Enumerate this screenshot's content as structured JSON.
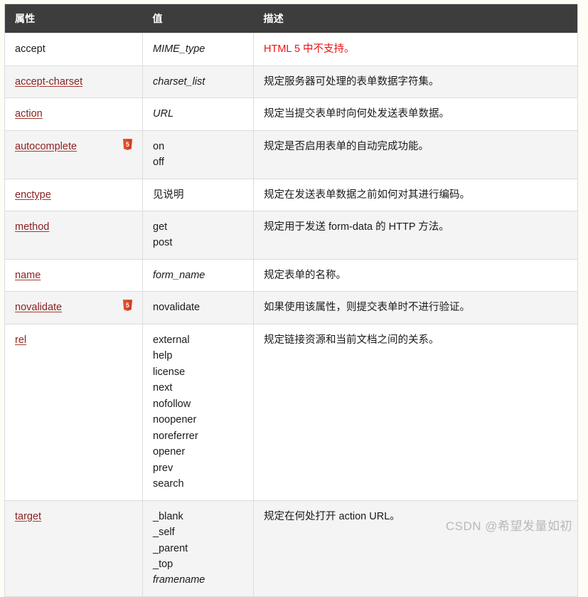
{
  "table": {
    "columns": [
      {
        "key": "attribute",
        "label": "属性"
      },
      {
        "key": "value",
        "label": "值"
      },
      {
        "key": "description",
        "label": "描述"
      }
    ],
    "rows": [
      {
        "attribute": "accept",
        "attribute_is_link": false,
        "html5_badge": false,
        "values": [
          "MIME_type"
        ],
        "values_italic": true,
        "description": "HTML 5 中不支持。",
        "description_color": "red"
      },
      {
        "attribute": "accept-charset",
        "attribute_is_link": true,
        "html5_badge": false,
        "values": [
          "charset_list"
        ],
        "values_italic": true,
        "description": "规定服务器可处理的表单数据字符集。",
        "description_color": "default"
      },
      {
        "attribute": "action",
        "attribute_is_link": true,
        "html5_badge": false,
        "values": [
          "URL"
        ],
        "values_italic": true,
        "description": "规定当提交表单时向何处发送表单数据。",
        "description_color": "default"
      },
      {
        "attribute": "autocomplete",
        "attribute_is_link": true,
        "html5_badge": true,
        "values": [
          "on",
          "off"
        ],
        "values_italic": false,
        "description": "规定是否启用表单的自动完成功能。",
        "description_color": "default"
      },
      {
        "attribute": "enctype",
        "attribute_is_link": true,
        "html5_badge": false,
        "values": [
          "见说明"
        ],
        "values_italic": false,
        "description": "规定在发送表单数据之前如何对其进行编码。",
        "description_color": "default"
      },
      {
        "attribute": "method",
        "attribute_is_link": true,
        "html5_badge": false,
        "values": [
          "get",
          "post"
        ],
        "values_italic": false,
        "description": "规定用于发送 form-data 的 HTTP 方法。",
        "description_color": "default"
      },
      {
        "attribute": "name",
        "attribute_is_link": true,
        "html5_badge": false,
        "values": [
          "form_name"
        ],
        "values_italic": true,
        "description": "规定表单的名称。",
        "description_color": "default"
      },
      {
        "attribute": "novalidate",
        "attribute_is_link": true,
        "html5_badge": true,
        "values": [
          "novalidate"
        ],
        "values_italic": false,
        "description": "如果使用该属性，则提交表单时不进行验证。",
        "description_color": "default"
      },
      {
        "attribute": "rel",
        "attribute_is_link": true,
        "html5_badge": false,
        "values": [
          "external",
          "help",
          "license",
          "next",
          "nofollow",
          "noopener",
          "noreferrer",
          "opener",
          "prev",
          "search"
        ],
        "values_italic": false,
        "description": "规定链接资源和当前文档之间的关系。",
        "description_color": "default"
      },
      {
        "attribute": "target",
        "attribute_is_link": true,
        "html5_badge": false,
        "values": [
          "_blank",
          "_self",
          "_parent",
          "_top",
          "framename"
        ],
        "values_italic": false,
        "values_italic_last": true,
        "description": "规定在何处打开 action URL。",
        "description_color": "default"
      }
    ]
  },
  "badge": {
    "name": "html5-logo-badge",
    "text": "5",
    "color": "#e44d26",
    "color_dark": "#cf3f1c"
  },
  "watermark": {
    "text": "CSDN @希望发量如初",
    "color": "#b9b9b9"
  },
  "colors": {
    "header_bg": "#3d3d3d",
    "header_text": "#ffffff",
    "link": "#8a2222",
    "danger": "#ee1111",
    "row_even_bg": "#f4f4f4",
    "row_odd_bg": "#ffffff",
    "border": "#dcdcdc",
    "page_bg": "#fdfdf5"
  }
}
